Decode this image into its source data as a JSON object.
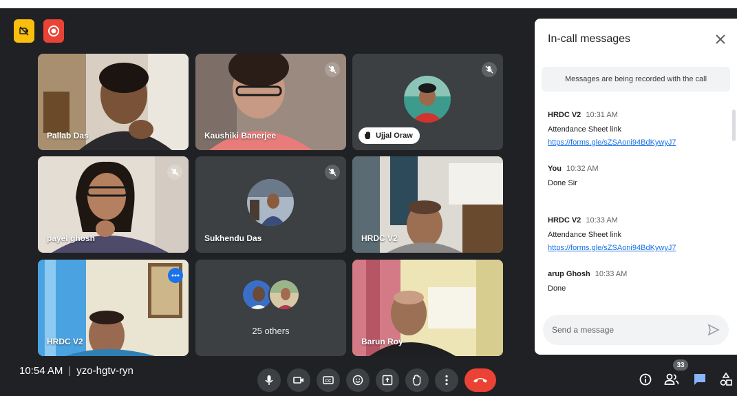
{
  "colors": {
    "background": "#202124",
    "tile": "#3c4043",
    "end_call": "#ea4335",
    "accent": "#1a73e8",
    "recording": "#ea4335",
    "no_video_badge": "#f9bf0c"
  },
  "top_badges": [
    {
      "icon": "video-off-icon"
    },
    {
      "icon": "record-icon"
    }
  ],
  "tiles": [
    {
      "name": "Pallab Das",
      "muted": false
    },
    {
      "name": "Kaushiki Banerjee",
      "muted": true
    },
    {
      "name": "Ujjal Oraw",
      "muted": true
    },
    {
      "name": "payel ghosh",
      "muted": true
    },
    {
      "name": "Sukhendu Das",
      "muted": true
    },
    {
      "name": "HRDC V2",
      "muted": false
    },
    {
      "name": "HRDC V2",
      "muted": false,
      "active": true
    },
    {
      "name": "25 others"
    },
    {
      "name": "Barun Roy",
      "muted": false
    }
  ],
  "meeting": {
    "time": "10:54 AM",
    "separator": "|",
    "code": "yzo-hgtv-ryn"
  },
  "controls": [
    {
      "icon": "mic-icon"
    },
    {
      "icon": "camera-icon"
    },
    {
      "icon": "captions-icon"
    },
    {
      "icon": "emoji-icon"
    },
    {
      "icon": "present-icon"
    },
    {
      "icon": "raise-hand-icon"
    },
    {
      "icon": "more-options-icon"
    },
    {
      "icon": "end-call-icon"
    }
  ],
  "right_controls": {
    "participants_count": "33",
    "icons": [
      "info-icon",
      "people-icon",
      "chat-icon",
      "activities-icon"
    ]
  },
  "chat": {
    "title": "In-call messages",
    "notice": "Messages are being recorded with the call",
    "messages": [
      {
        "sender": "HRDC V2",
        "time": "10:31 AM",
        "lines": [
          "Attendance Sheet link"
        ],
        "link": "https://forms.gle/sZSAoni94BdKywyJ7"
      },
      {
        "sender": "You",
        "time": "10:32 AM",
        "lines": [
          "Done Sir"
        ],
        "link": ""
      },
      {
        "sender": "HRDC V2",
        "time": "10:33 AM",
        "lines": [
          "Attendance Sheet link"
        ],
        "link": "https://forms.gle/sZSAoni94BdKywyJ7"
      },
      {
        "sender": "arup Ghosh",
        "time": "10:33 AM",
        "lines": [
          "Done"
        ],
        "link": ""
      }
    ],
    "input_placeholder": "Send a message"
  }
}
